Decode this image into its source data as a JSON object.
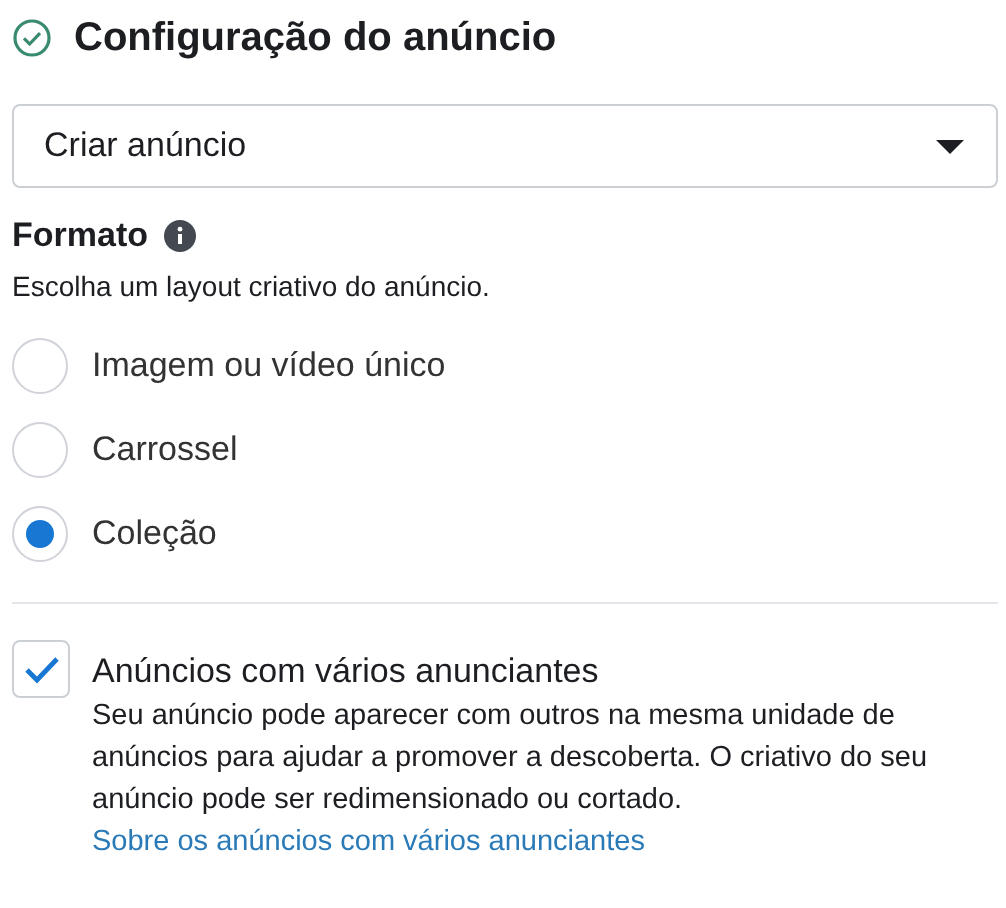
{
  "section": {
    "title": "Configuração do anúncio",
    "complete": true
  },
  "dropdown": {
    "value": "Criar anúncio"
  },
  "format": {
    "title": "Formato",
    "description": "Escolha um layout criativo do anúncio.",
    "options": [
      {
        "label": "Imagem ou vídeo único",
        "selected": false
      },
      {
        "label": "Carrossel",
        "selected": false
      },
      {
        "label": "Coleção",
        "selected": true
      }
    ]
  },
  "multi_advertiser": {
    "label": "Anúncios com vários anunciantes",
    "checked": true,
    "description": "Seu anúncio pode aparecer com outros na mesma unidade de anúncios para ajudar a promover a descoberta. O criativo do seu anúncio pode ser redimensionado ou cortado.",
    "link": "Sobre os anúncios com vários anunciantes"
  }
}
